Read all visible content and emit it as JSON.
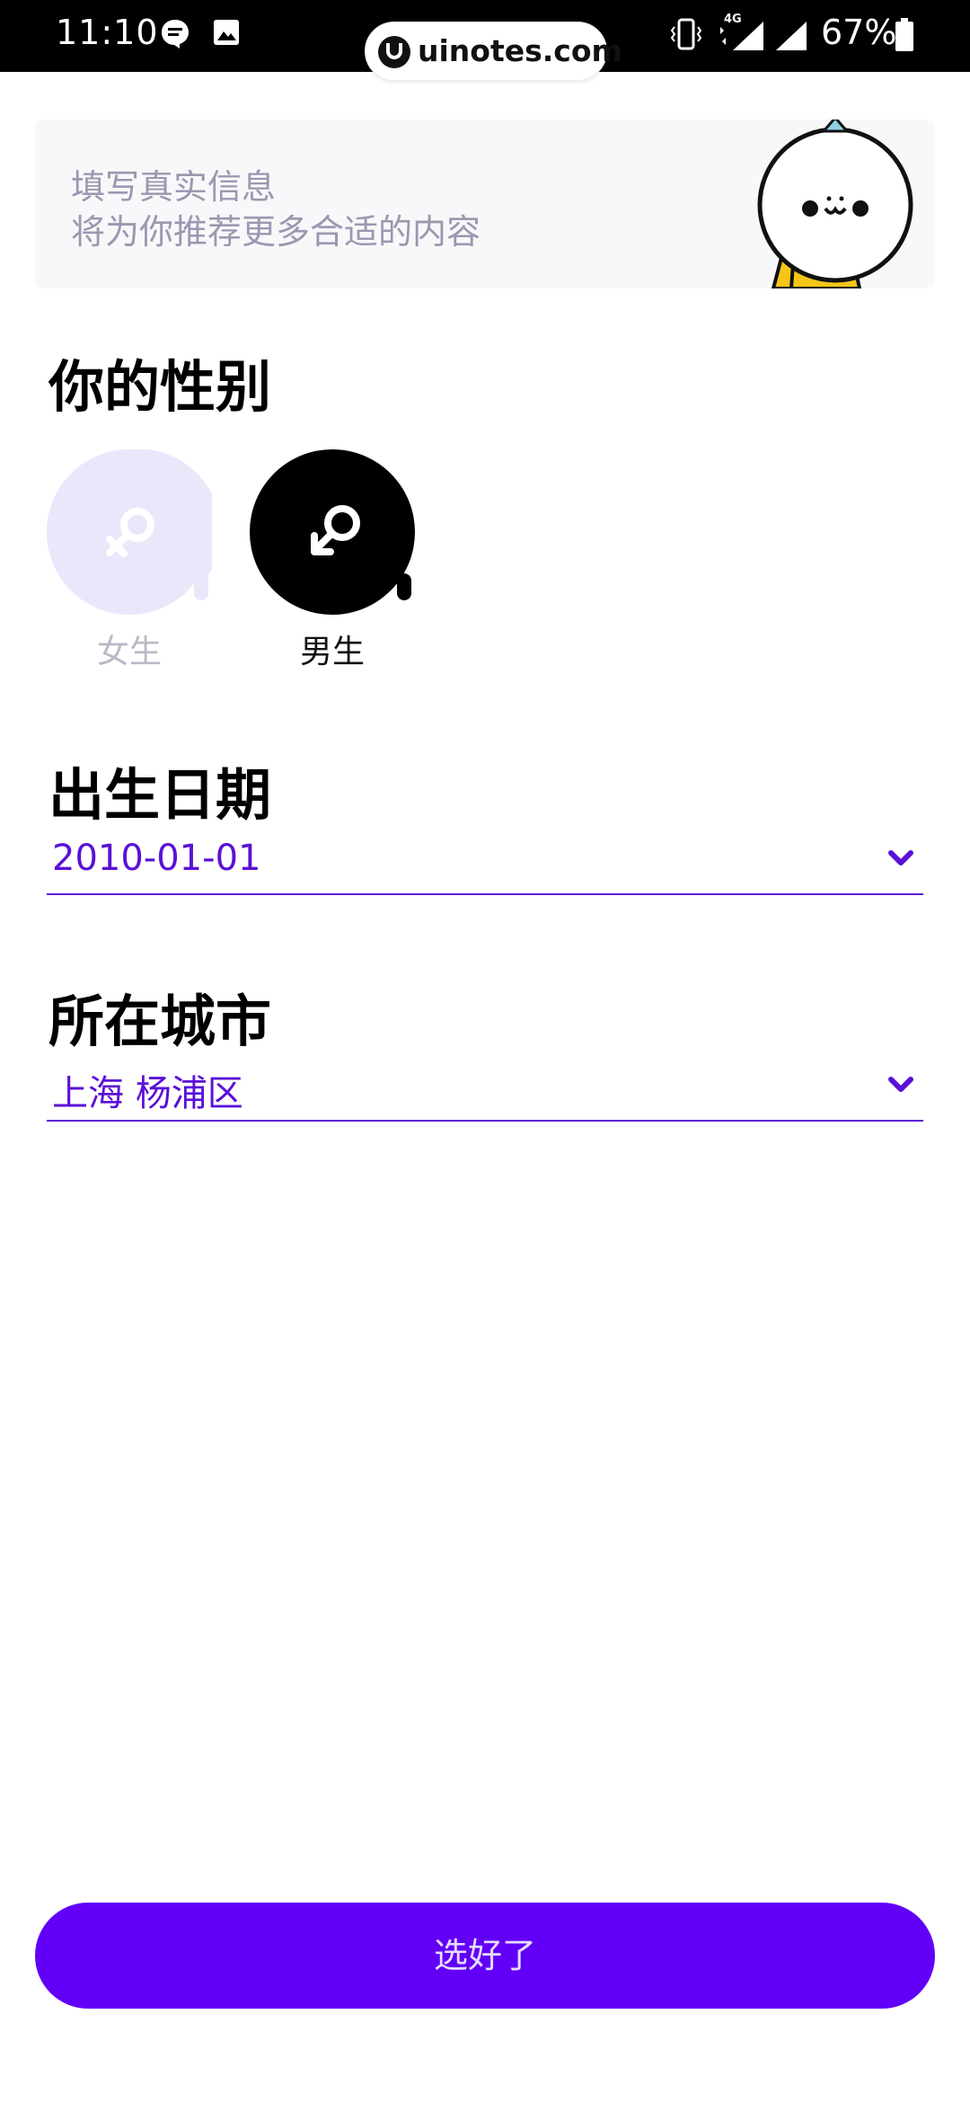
{
  "status_bar": {
    "time": "11:10",
    "network": "4G",
    "battery": "67%"
  },
  "watermark": {
    "text": "uinotes.com"
  },
  "banner": {
    "line1": "填写真实信息",
    "line2": "将为你推荐更多合适的内容"
  },
  "gender": {
    "title": "你的性别",
    "options": [
      {
        "label": "女生",
        "selected": false
      },
      {
        "label": "男生",
        "selected": true
      }
    ]
  },
  "birth": {
    "title": "出生日期",
    "value": "2010-01-01"
  },
  "city": {
    "title": "所在城市",
    "value": "上海 杨浦区"
  },
  "submit": {
    "label": "选好了"
  },
  "colors": {
    "accent": "#6200f7",
    "field_text": "#5a10d6",
    "female_bg": "#ece6fb",
    "male_bg": "#000000"
  }
}
